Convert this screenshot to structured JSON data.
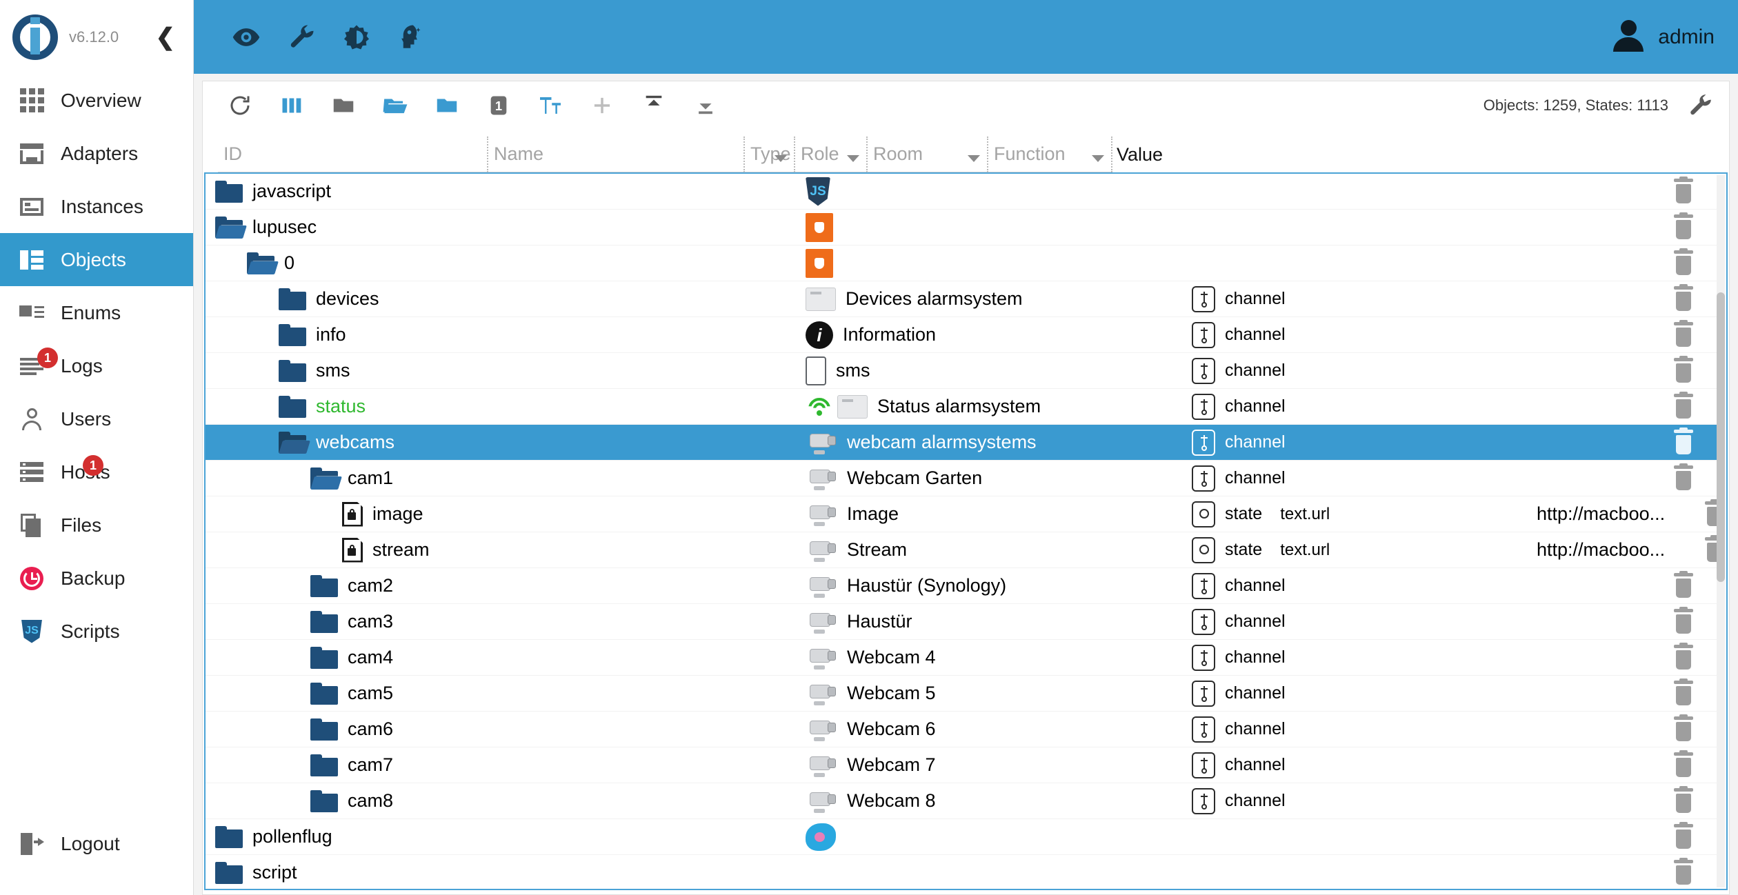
{
  "app": {
    "version": "v6.12.0",
    "collapse_icon": "chevron-left-icon"
  },
  "appbar": {
    "icons": [
      "eye-icon",
      "wrench-icon",
      "brightness-icon",
      "expert-head-icon"
    ],
    "user": "admin"
  },
  "sidebar": {
    "items": [
      {
        "label": "Overview",
        "icon": "grid-icon",
        "badge": ""
      },
      {
        "label": "Adapters",
        "icon": "store-icon",
        "badge": ""
      },
      {
        "label": "Instances",
        "icon": "instances-icon",
        "badge": ""
      },
      {
        "label": "Objects",
        "icon": "objects-icon",
        "badge": "",
        "active": true
      },
      {
        "label": "Enums",
        "icon": "enums-icon",
        "badge": ""
      },
      {
        "label": "Logs",
        "icon": "logs-icon",
        "badge": "1"
      },
      {
        "label": "Users",
        "icon": "user-icon",
        "badge": ""
      },
      {
        "label": "Hosts",
        "icon": "hosts-icon",
        "badge": "1"
      },
      {
        "label": "Files",
        "icon": "files-icon",
        "badge": ""
      },
      {
        "label": "Backup",
        "icon": "backup-icon",
        "badge": ""
      },
      {
        "label": "Scripts",
        "icon": "javascript-icon",
        "badge": ""
      }
    ],
    "logout": {
      "label": "Logout",
      "icon": "logout-icon"
    }
  },
  "toolbar": {
    "buttons": [
      "refresh-icon",
      "columns-icon",
      "collapse-all-icon",
      "expand-all-icon",
      "expand-one-icon",
      "depth-one-icon",
      "text-size-icon",
      "add-icon",
      "import-icon",
      "export-icon"
    ],
    "stats": "Objects: 1259, States: 1113",
    "settings_icon": "wrench-icon"
  },
  "filters": {
    "id": {
      "placeholder": "ID",
      "value": ""
    },
    "name": {
      "placeholder": "Name",
      "value": ""
    },
    "type": {
      "placeholder": "Type",
      "value": ""
    },
    "role": {
      "placeholder": "Role",
      "value": ""
    },
    "room": {
      "placeholder": "Room",
      "value": ""
    },
    "function": {
      "placeholder": "Function",
      "value": ""
    },
    "value_header": "Value"
  },
  "tree": {
    "rows": [
      {
        "id": "javascript",
        "indent": 0,
        "icon": "folder-closed-icon",
        "name": "",
        "name_icon": "javascript-icon",
        "type": "",
        "role": "",
        "value": ""
      },
      {
        "id": "lupusec",
        "indent": 0,
        "icon": "folder-open-icon",
        "name": "",
        "name_icon": "lupus-icon",
        "type": "",
        "role": "",
        "value": ""
      },
      {
        "id": "0",
        "indent": 1,
        "icon": "folder-open-icon",
        "name": "",
        "name_icon": "lupus-icon",
        "type": "",
        "role": "",
        "value": ""
      },
      {
        "id": "devices",
        "indent": 2,
        "icon": "folder-closed-icon",
        "name": "Devices alarmsystem",
        "name_icon": "panel-icon",
        "type": "channel",
        "role": "",
        "value": ""
      },
      {
        "id": "info",
        "indent": 2,
        "icon": "folder-closed-icon",
        "name": "Information",
        "name_icon": "info-icon",
        "type": "channel",
        "role": "",
        "value": ""
      },
      {
        "id": "sms",
        "indent": 2,
        "icon": "folder-closed-icon",
        "name": "sms",
        "name_icon": "phone-icon",
        "type": "channel",
        "role": "",
        "value": ""
      },
      {
        "id": "status",
        "indent": 2,
        "icon": "folder-closed-icon",
        "id_color": "green",
        "status_icon": "wifi-icon",
        "name": "Status alarmsystem",
        "name_icon": "panel-icon",
        "type": "channel",
        "role": "",
        "value": ""
      },
      {
        "id": "webcams",
        "indent": 2,
        "icon": "folder-open-icon",
        "selected": true,
        "name": "webcam alarmsystems",
        "name_icon": "camera-icon",
        "type": "channel",
        "role": "",
        "value": ""
      },
      {
        "id": "cam1",
        "indent": 3,
        "icon": "folder-open-icon",
        "name": "Webcam Garten",
        "name_icon": "camera-icon",
        "type": "channel",
        "role": "",
        "value": ""
      },
      {
        "id": "image",
        "indent": 4,
        "icon": "document-lock-icon",
        "name": "Image",
        "name_icon": "camera-icon",
        "type": "state",
        "role": "text.url",
        "value": "http://macboo..."
      },
      {
        "id": "stream",
        "indent": 4,
        "icon": "document-lock-icon",
        "name": "Stream",
        "name_icon": "camera-icon",
        "type": "state",
        "role": "text.url",
        "value": "http://macboo..."
      },
      {
        "id": "cam2",
        "indent": 3,
        "icon": "folder-closed-icon",
        "name": "Haustür (Synology)",
        "name_icon": "camera-icon",
        "type": "channel",
        "role": "",
        "value": ""
      },
      {
        "id": "cam3",
        "indent": 3,
        "icon": "folder-closed-icon",
        "name": "Haustür",
        "name_icon": "camera-icon",
        "type": "channel",
        "role": "",
        "value": ""
      },
      {
        "id": "cam4",
        "indent": 3,
        "icon": "folder-closed-icon",
        "name": "Webcam 4",
        "name_icon": "camera-icon",
        "type": "channel",
        "role": "",
        "value": ""
      },
      {
        "id": "cam5",
        "indent": 3,
        "icon": "folder-closed-icon",
        "name": "Webcam 5",
        "name_icon": "camera-icon",
        "type": "channel",
        "role": "",
        "value": ""
      },
      {
        "id": "cam6",
        "indent": 3,
        "icon": "folder-closed-icon",
        "name": "Webcam 6",
        "name_icon": "camera-icon",
        "type": "channel",
        "role": "",
        "value": ""
      },
      {
        "id": "cam7",
        "indent": 3,
        "icon": "folder-closed-icon",
        "name": "Webcam 7",
        "name_icon": "camera-icon",
        "type": "channel",
        "role": "",
        "value": ""
      },
      {
        "id": "cam8",
        "indent": 3,
        "icon": "folder-closed-icon",
        "name": "Webcam 8",
        "name_icon": "camera-icon",
        "type": "channel",
        "role": "",
        "value": ""
      },
      {
        "id": "pollenflug",
        "indent": 0,
        "icon": "folder-closed-icon",
        "name": "",
        "name_icon": "pollen-icon",
        "type": "",
        "role": "",
        "value": ""
      },
      {
        "id": "script",
        "indent": 0,
        "icon": "folder-closed-icon",
        "name": "",
        "name_icon": "",
        "type": "",
        "role": "",
        "value": ""
      }
    ],
    "delete_icon": "trash-icon"
  },
  "colors": {
    "accent": "#3a9ad0",
    "folder": "#1f4e79",
    "badge": "#d32f2f",
    "green_text": "#2fb82f"
  }
}
